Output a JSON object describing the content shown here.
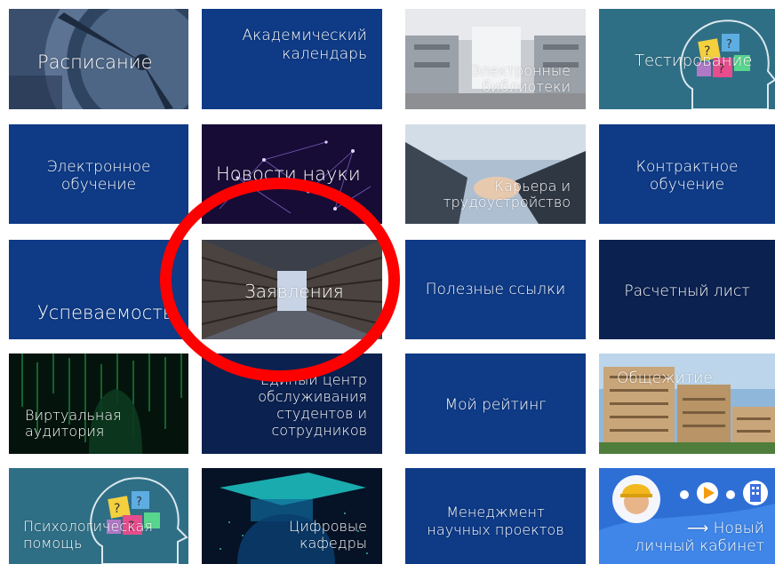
{
  "tiles": {
    "schedule": "Расписание",
    "academic_calendar": [
      "Академический",
      "календарь"
    ],
    "e_libraries": [
      "Электронные",
      "библиотеки"
    ],
    "testing": "Тестирование",
    "e_learning": [
      "Электронное",
      "обучение"
    ],
    "science_news": "Новости науки",
    "career": [
      "Карьера и",
      "трудоустройство"
    ],
    "contract_learning": [
      "Контрактное",
      "обучение"
    ],
    "performance": "Успеваемость",
    "applications": "Заявления",
    "useful_links": "Полезные ссылки",
    "payslip": "Расчетный лист",
    "virtual_classroom": [
      "Виртуальная",
      "аудитория"
    ],
    "service_center": [
      "Единый центр",
      "обслуживания",
      "студентов и",
      "сотрудников"
    ],
    "my_rating": "Мой рейтинг",
    "dormitory": "Общежитие",
    "psych_help": [
      "Психологическая",
      "помощь"
    ],
    "digital_departments": [
      "Цифровые",
      "кафедры"
    ],
    "research_management": [
      "Менеджмент",
      "научных проектов"
    ],
    "new_cabinet": [
      "Новый",
      "личный кабинет"
    ],
    "new_cabinet_arrow": "⟶"
  },
  "colors": {
    "tile_blue": "#0e3a86",
    "tile_dark": "#0b2150",
    "annotation": "#ff0000"
  }
}
